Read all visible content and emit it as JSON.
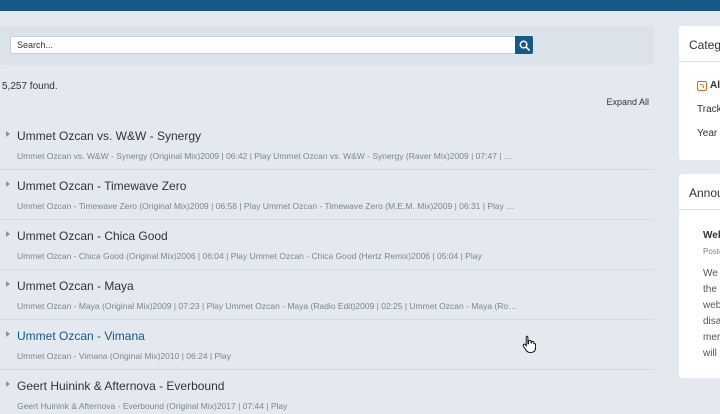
{
  "search": {
    "placeholder": "Search..."
  },
  "found_text": "5,257 found.",
  "expand_all": "Expand All",
  "results": [
    {
      "title": "Ummet Ozcan vs. W&W - Synergy",
      "meta": "Ummet Ozcan vs. W&W - Synergy (Original Mix)2009 | 06:42 | Play Ummet Ozcan vs. W&W - Synergy (Raver Mix)2009 | 07:47 | Play..."
    },
    {
      "title": "Ummet Ozcan - Timewave Zero",
      "meta": "Ummet Ozcan - Timewave Zero (Original Mix)2009 | 06:58 | Play Ummet Ozcan - Timewave Zero (M.E.M. Mix)2009 | 06:31 | Play U..."
    },
    {
      "title": "Ummet Ozcan - Chica Good",
      "meta": "Ummet Ozcan - Chica Good (Original Mix)2006 | 06:04 | Play Ummet Ozcan - Chica Good (Hertz Remix)2006 | 05:04 | Play"
    },
    {
      "title": "Ummet Ozcan - Maya",
      "meta": "Ummet Ozcan - Maya (Original Mix)2009 | 07:23 | Play Ummet Ozcan - Maya (Radio Edit)2009 | 02:25 | Ummet Ozcan - Maya (Robb..."
    },
    {
      "title": "Ummet Ozcan - Vimana",
      "meta": "Ummet Ozcan - Vimana (Original Mix)2010 | 06:24 | Play"
    },
    {
      "title": "Geert Huinink & Afternova - Everbound",
      "meta": "Geert Huinink & Afternova - Everbound (Original Mix)2017 | 07:44 | Play"
    }
  ],
  "sidebar": {
    "categories": {
      "heading": "Categ",
      "all": "Al",
      "items": [
        "Track",
        "Year"
      ]
    },
    "announcements": {
      "heading": "Annou",
      "title": "Wel",
      "posted": "Poste",
      "lines": [
        "We",
        "the",
        "web",
        "disa",
        "mer",
        "will"
      ]
    }
  },
  "colors": {
    "brand": "#185886",
    "link_hover": "#185886",
    "rss": "#e06a1b"
  }
}
